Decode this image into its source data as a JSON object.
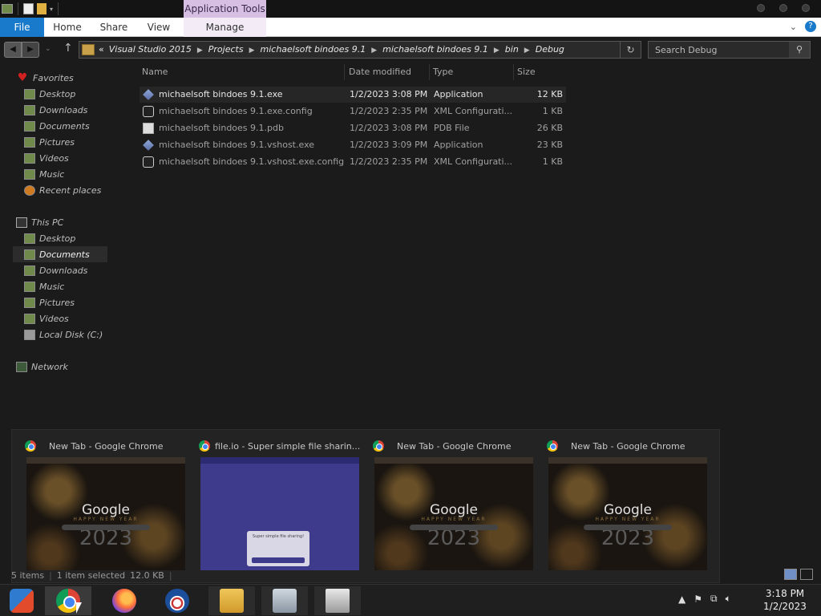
{
  "ribbon": {
    "contextual_title": "Application Tools",
    "tabs": [
      {
        "label": "File"
      },
      {
        "label": "Home"
      },
      {
        "label": "Share"
      },
      {
        "label": "View"
      },
      {
        "label": "Manage"
      }
    ]
  },
  "address": {
    "overflow": "«",
    "crumbs": [
      "Visual Studio 2015",
      "Projects",
      "michaelsoft bindoes 9.1",
      "michaelsoft bindoes 9.1",
      "bin",
      "Debug"
    ]
  },
  "search": {
    "placeholder": "Search Debug"
  },
  "sidebar": {
    "favorites_label": "Favorites",
    "favorites": [
      "Desktop",
      "Downloads",
      "Documents",
      "Pictures",
      "Videos",
      "Music",
      "Recent places"
    ],
    "thispc_label": "This PC",
    "thispc": [
      "Desktop",
      "Documents",
      "Downloads",
      "Music",
      "Pictures",
      "Videos",
      "Local Disk (C:)"
    ],
    "network_label": "Network"
  },
  "columns": {
    "name": "Name",
    "date": "Date modified",
    "type": "Type",
    "size": "Size"
  },
  "files": [
    {
      "name": "michaelsoft bindoes 9.1.exe",
      "date": "1/2/2023 3:08 PM",
      "type": "Application",
      "size": "12 KB",
      "icon": "app-icon"
    },
    {
      "name": "michaelsoft bindoes 9.1.exe.config",
      "date": "1/2/2023 2:35 PM",
      "type": "XML Configurati...",
      "size": "1 KB",
      "icon": "config-file-icon"
    },
    {
      "name": "michaelsoft bindoes 9.1.pdb",
      "date": "1/2/2023 3:08 PM",
      "type": "PDB File",
      "size": "26 KB",
      "icon": "file-icon"
    },
    {
      "name": "michaelsoft bindoes 9.1.vshost.exe",
      "date": "1/2/2023 3:09 PM",
      "type": "Application",
      "size": "23 KB",
      "icon": "app-icon"
    },
    {
      "name": "michaelsoft bindoes 9.1.vshost.exe.config",
      "date": "1/2/2023 2:35 PM",
      "type": "XML Configurati...",
      "size": "1 KB",
      "icon": "config-file-icon"
    }
  ],
  "thumbnails": [
    {
      "title": "New Tab - Google Chrome",
      "logo": "Google",
      "sub": "HAPPY NEW YEAR",
      "year": "2023"
    },
    {
      "title": "file.io - Super simple file sharin...",
      "card": "Super simple file sharing!"
    },
    {
      "title": "New Tab - Google Chrome",
      "logo": "Google",
      "sub": "HAPPY NEW YEAR",
      "year": "2023"
    },
    {
      "title": "New Tab - Google Chrome",
      "logo": "Google",
      "sub": "HAPPY NEW YEAR",
      "year": "2023"
    }
  ],
  "status": {
    "items": "5 items",
    "selected": "1 item selected",
    "size": "12.0 KB"
  },
  "clock": {
    "time": "3:18 PM",
    "date": "1/2/2023"
  },
  "colors": {
    "accent": "#1979ca",
    "context_tab": "#d6bfe3",
    "background": "#1b1b1b"
  }
}
